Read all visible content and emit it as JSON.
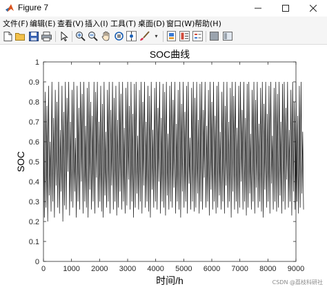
{
  "window": {
    "title": "Figure 7"
  },
  "menu": [
    "文件(F)",
    "编辑(E)",
    "查看(V)",
    "插入(I)",
    "工具(T)",
    "桌面(D)",
    "窗口(W)",
    "帮助(H)"
  ],
  "toolbar": [
    {
      "name": "new-figure-icon"
    },
    {
      "name": "open-file-icon"
    },
    {
      "name": "save-icon"
    },
    {
      "name": "print-icon"
    },
    {
      "name": "select-arrow-icon"
    },
    {
      "name": "zoom-in-icon"
    },
    {
      "name": "zoom-out-icon"
    },
    {
      "name": "pan-hand-icon"
    },
    {
      "name": "rotate-3d-icon"
    },
    {
      "name": "data-cursor-icon"
    },
    {
      "name": "brush-icon"
    },
    {
      "name": "link-plot-icon"
    },
    {
      "name": "colorbar-icon"
    },
    {
      "name": "legend-icon"
    },
    {
      "name": "hide-plot-tools-icon"
    },
    {
      "name": "show-plot-tools-icon"
    }
  ],
  "chart_data": {
    "type": "line",
    "title": "SOC曲线",
    "xlabel": "时间/h",
    "ylabel": "SOC",
    "xlim": [
      0,
      9000
    ],
    "ylim": [
      0,
      1
    ],
    "xticks": [
      "0",
      "1000",
      "2000",
      "3000",
      "4000",
      "5000",
      "6000",
      "7000",
      "8000",
      "9000"
    ],
    "yticks": [
      "0",
      "0.1",
      "0.2",
      "0.3",
      "0.4",
      "0.5",
      "0.6",
      "0.7",
      "0.8",
      "0.9",
      "1"
    ],
    "grid": false,
    "series": [
      {
        "color": "#000000",
        "x_start": 1,
        "x_step": 30,
        "values": [
          0.9,
          0.22,
          0.85,
          0.27,
          0.78,
          0.2,
          0.88,
          0.33,
          0.6,
          0.25,
          0.9,
          0.3,
          0.72,
          0.22,
          0.86,
          0.38,
          0.8,
          0.27,
          0.9,
          0.24,
          0.66,
          0.35,
          0.88,
          0.2,
          0.75,
          0.28,
          0.9,
          0.26,
          0.82,
          0.45,
          0.9,
          0.23,
          0.7,
          0.3,
          0.86,
          0.27,
          0.9,
          0.35,
          0.62,
          0.22,
          0.88,
          0.3,
          0.77,
          0.26,
          0.9,
          0.4,
          0.84,
          0.24,
          0.9,
          0.3,
          0.68,
          0.27,
          0.87,
          0.22,
          0.9,
          0.36,
          0.8,
          0.26,
          0.73,
          0.3,
          0.9,
          0.24,
          0.85,
          0.42,
          0.9,
          0.27,
          0.7,
          0.3,
          0.88,
          0.25,
          0.79,
          0.22,
          0.9,
          0.33,
          0.65,
          0.27,
          0.86,
          0.3,
          0.9,
          0.24,
          0.76,
          0.38,
          0.9,
          0.26,
          0.82,
          0.3,
          0.88,
          0.23,
          0.71,
          0.27,
          0.9,
          0.35,
          0.84,
          0.26,
          0.9,
          0.3,
          0.67,
          0.24,
          0.87,
          0.28,
          0.9,
          0.41,
          0.78,
          0.26,
          0.9,
          0.3,
          0.74,
          0.22,
          0.89,
          0.27,
          0.9,
          0.34,
          0.63,
          0.26,
          0.86,
          0.3,
          0.9,
          0.24,
          0.8,
          0.38,
          0.9,
          0.27,
          0.7,
          0.3,
          0.88,
          0.25,
          0.83,
          0.22,
          0.9,
          0.36,
          0.66,
          0.27,
          0.87,
          0.3,
          0.9,
          0.26,
          0.77,
          0.4,
          0.9,
          0.24,
          0.72,
          0.3,
          0.89,
          0.27,
          0.85,
          0.23,
          0.9,
          0.33,
          0.64,
          0.26,
          0.88,
          0.3,
          0.9,
          0.27,
          0.81,
          0.37,
          0.9,
          0.24,
          0.69,
          0.3,
          0.86,
          0.26,
          0.9,
          0.22,
          0.79,
          0.35,
          0.9,
          0.27,
          0.75,
          0.3,
          0.88,
          0.24,
          0.9,
          0.39,
          0.62,
          0.26,
          0.87,
          0.3,
          0.9,
          0.25,
          0.82,
          0.27,
          0.9,
          0.34,
          0.71,
          0.24,
          0.89,
          0.3,
          0.9,
          0.26,
          0.76,
          0.42,
          0.9,
          0.27,
          0.68,
          0.3,
          0.86,
          0.23,
          0.9,
          0.36,
          0.8,
          0.26,
          0.9,
          0.3,
          0.73,
          0.24,
          0.88,
          0.27,
          0.9,
          0.33,
          0.65,
          0.26,
          0.85,
          0.3,
          0.9,
          0.24,
          0.78,
          0.38,
          0.9,
          0.27,
          0.7,
          0.3,
          0.87,
          0.22,
          0.9,
          0.35,
          0.83,
          0.26,
          0.9,
          0.3,
          0.67,
          0.24,
          0.88,
          0.27,
          0.9,
          0.4,
          0.76,
          0.26,
          0.9,
          0.3,
          0.72,
          0.23,
          0.89,
          0.27,
          0.9,
          0.34,
          0.64,
          0.26,
          0.86,
          0.3,
          0.9,
          0.24,
          0.81,
          0.37,
          0.9,
          0.27,
          0.69,
          0.3,
          0.87,
          0.25,
          0.9,
          0.22,
          0.79,
          0.36,
          0.9,
          0.27,
          0.74,
          0.3,
          0.88,
          0.24,
          0.9,
          0.39,
          0.63,
          0.26,
          0.87,
          0.3,
          0.9,
          0.25,
          0.84,
          0.27,
          0.9,
          0.33,
          0.7,
          0.24,
          0.89,
          0.3,
          0.9,
          0.26,
          0.77,
          0.41,
          0.9,
          0.27,
          0.66,
          0.3,
          0.86,
          0.23,
          0.9,
          0.35,
          0.8,
          0.26,
          0.9,
          0.3,
          0.73,
          0.24,
          0.88,
          0.27,
          0.9,
          0.34,
          0.65,
          0.26
        ]
      }
    ]
  },
  "watermark": "CSDN @荔枝科研社"
}
